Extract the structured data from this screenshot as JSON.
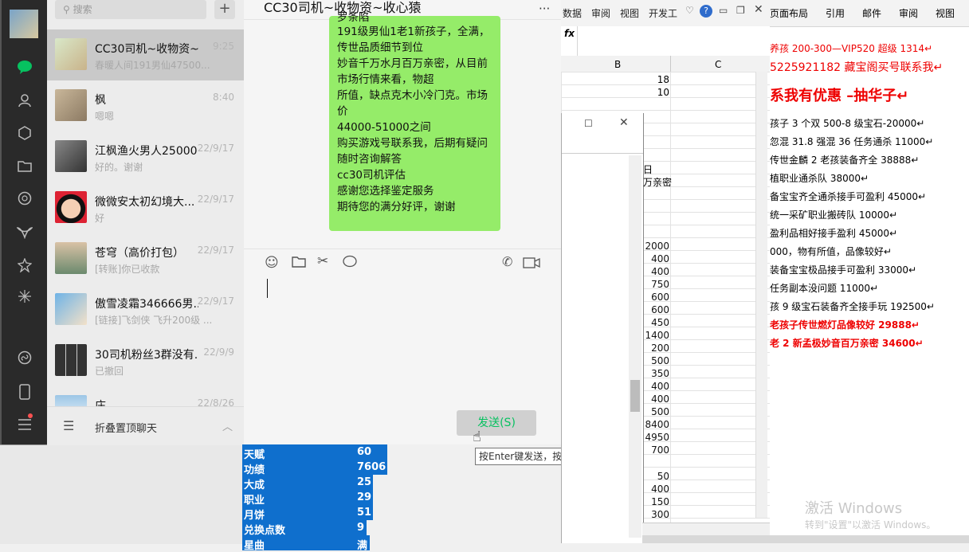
{
  "wechat": {
    "search_placeholder": "搜索",
    "add_icon": "plus-icon",
    "conversations": [
      {
        "name": "CC30司机~收物资~...",
        "time": "9:25",
        "preview": "春暖人间191男仙47500..."
      },
      {
        "name": "枫",
        "time": "8:40",
        "preview": "嗯嗯"
      },
      {
        "name": "江枫渔火男人25000",
        "time": "22/9/17",
        "preview": "好的。谢谢"
      },
      {
        "name": "微微安太初幻境大...",
        "time": "22/9/17",
        "preview": "好"
      },
      {
        "name": "苍穹（高价打包）",
        "time": "22/9/17",
        "preview": "[转账]你已收款"
      },
      {
        "name": "傲雪凌霜346666男...",
        "time": "22/9/17",
        "preview": "[链接]飞剑侠 飞升200级 ..."
      },
      {
        "name": "30司机粉丝3群没有...",
        "time": "22/9/9",
        "preview": "已撤回"
      },
      {
        "name": "庄",
        "time": "22/8/26",
        "preview": ""
      }
    ],
    "fold_label": "折叠置顶聊天"
  },
  "chat": {
    "title": "CC30司机~收物资~收心猿",
    "menu": "···",
    "message_lines": [
      "罗条陷",
      "191级男仙1老1新孩子，全满，",
      "传世品质细节到位",
      "妙音千万水月百万亲密，从目前",
      "市场行情来看，物超",
      "所值，缺点克木小冷门克。市场",
      "价",
      "44000-51000之间",
      "购买游戏号联系我，后期有疑问",
      "随时咨询解答",
      "cc30司机评估",
      "感谢您选择鉴定服务",
      "期待您的满分好评，谢谢"
    ],
    "send_label": "发送(S)",
    "tooltip": "按Enter键发送，按Ctrl+Enter键换行"
  },
  "excel": {
    "tabs": [
      "数据",
      "审阅",
      "视图",
      "开发工"
    ],
    "fx": "fx",
    "col_b": "B",
    "col_c": "C",
    "top_values": [
      "18",
      "10"
    ],
    "side_text": [
      "日",
      "万亲密"
    ],
    "values": [
      "2000",
      "400",
      "400",
      "750",
      "600",
      "600",
      "450",
      "1400",
      "200",
      "500",
      "350",
      "400",
      "400",
      "500",
      "8400",
      "4950",
      "700",
      "",
      "50",
      "400",
      "150",
      "300"
    ]
  },
  "blue_table": [
    {
      "label": "天赋",
      "value": "60"
    },
    {
      "label": "功绩",
      "value": "7606"
    },
    {
      "label": "大成",
      "value": "25"
    },
    {
      "label": "职业",
      "value": "29"
    },
    {
      "label": "月饼",
      "value": "51"
    },
    {
      "label": "兑换点数",
      "value": "9"
    },
    {
      "label": "星曲",
      "value": "满"
    }
  ],
  "word": {
    "tabs": [
      "页面布局",
      "引用",
      "邮件",
      "审阅",
      "视图"
    ],
    "lines": [
      "养孩 200-300—VIP520 超级 1314↵",
      "5225921182  藏宝阁买号联系我↵",
      "系我有优惠 –抽华子↵",
      "孩子 3 个双 500-8 级宝石-20000↵",
      "忽混 31.8 强混 36 任务通杀 11000↵",
      "传世金麟 2 老孩装备齐全 38888↵",
      "植职业通杀队 38000↵",
      "备宝宝齐全通杀接手可盈利 45000↵",
      "统一采矿职业搬砖队 10000↵",
      "盈利品相好接手盈利 45000↵",
      "000，物有所值，品像较好↵",
      "装备宝宝极品接手可盈利 33000↵",
      "任务副本没问题 11000↵",
      "孩 9 级宝石装备齐全接手玩 192500↵",
      " 老孩子传世燃灯品像较好 29888↵",
      "老 2 新孟极妙音百万亲密 34600↵"
    ],
    "watermark": "激活 Windows",
    "watermark_sub": "转到\"设置\"以激活 Windows。"
  }
}
